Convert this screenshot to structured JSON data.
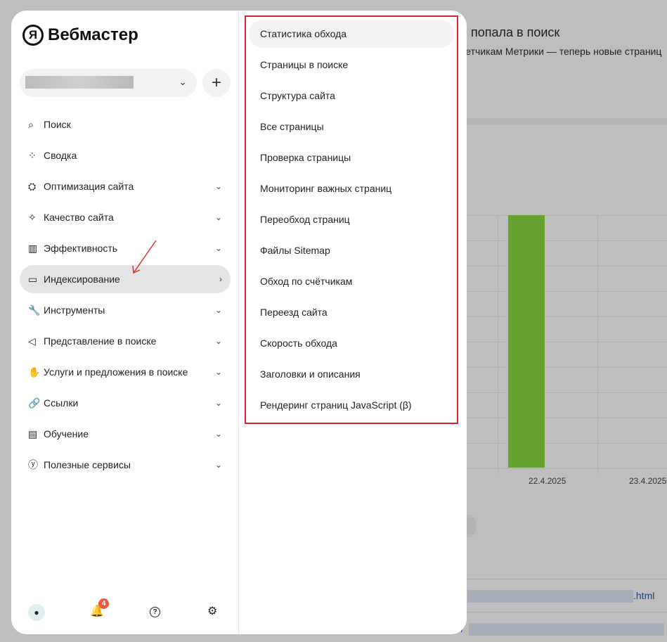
{
  "background": {
    "title": "е попала в поиск",
    "subtitle": "четчикам Метрики — теперь новые страниц",
    "chart": {
      "x_labels": [
        "22.4.2025",
        "23.4.2025"
      ],
      "bar_color": "#65a22f"
    },
    "links": [
      ".html",
      "://"
    ]
  },
  "sidebar": {
    "logo": "Вебмастер",
    "logo_mark": "Я",
    "site_chevron": "⌄",
    "add_label": "+",
    "items": [
      {
        "label": "Поиск",
        "icon": "⌕",
        "chev": ""
      },
      {
        "label": "Сводка",
        "icon": "⁘",
        "chev": ""
      },
      {
        "label": "Оптимизация сайта",
        "icon": "⛭",
        "chev": "⌄"
      },
      {
        "label": "Качество сайта",
        "icon": "✧",
        "chev": "⌄"
      },
      {
        "label": "Эффективность",
        "icon": "▥",
        "chev": "⌄"
      },
      {
        "label": "Индексирование",
        "icon": "▭",
        "chev": "›"
      },
      {
        "label": "Инструменты",
        "icon": "🔧",
        "chev": "⌄"
      },
      {
        "label": "Представление в поиске",
        "icon": "◁",
        "chev": "⌄"
      },
      {
        "label": "Услуги и предложения в поиске",
        "icon": "✋",
        "chev": "⌄"
      },
      {
        "label": "Ссылки",
        "icon": "🔗",
        "chev": "⌄"
      },
      {
        "label": "Обучение",
        "icon": "▤",
        "chev": "⌄"
      },
      {
        "label": "Полезные сервисы",
        "icon": "ⓨ",
        "chev": "⌄"
      }
    ],
    "footer": {
      "notifications_count": "4",
      "bell": "🔔",
      "help": "?",
      "settings": "⚙"
    }
  },
  "submenu": {
    "items": [
      "Статистика обхода",
      "Страницы в поиске",
      "Структура сайта",
      "Все страницы",
      "Проверка страницы",
      "Мониторинг важных страниц",
      "Переобход страниц",
      "Файлы Sitemap",
      "Обход по счётчикам",
      "Переезд сайта",
      "Скорость обхода",
      "Заголовки и описания",
      "Рендеринг страниц JavaScript (β)"
    ]
  },
  "colors": {
    "highlight_border": "#d7262d",
    "annotation_arrow": "#e0342f",
    "badge": "#f0573c"
  }
}
